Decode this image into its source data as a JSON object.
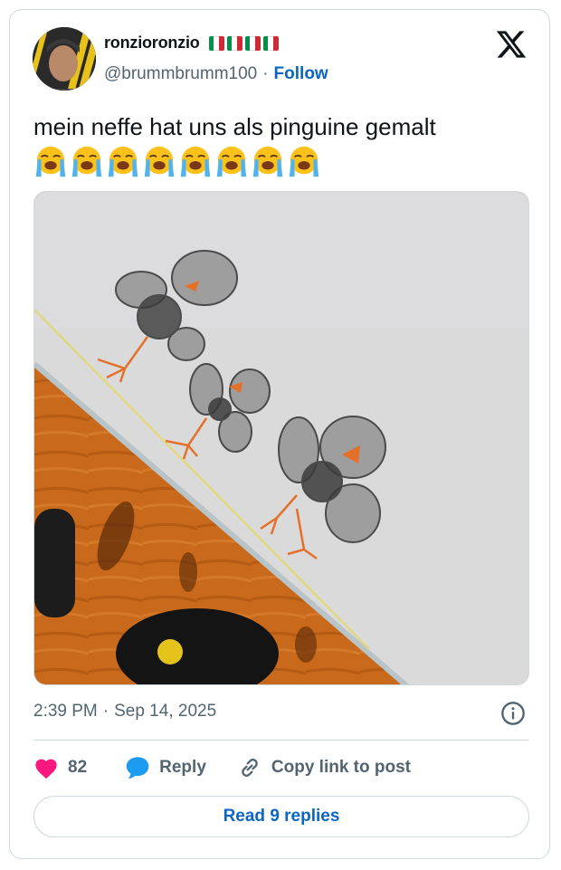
{
  "user": {
    "display_name": "ronzioronzio",
    "flags": [
      "italy-flag",
      "italy-flag",
      "italy-flag",
      "italy-flag"
    ],
    "handle": "@brummbrumm100",
    "separator": "·",
    "follow_label": "Follow"
  },
  "tweet": {
    "text": "mein neffe hat uns als pinguine gemalt",
    "emoji": [
      "loudly-crying-face",
      "loudly-crying-face",
      "loudly-crying-face",
      "loudly-crying-face",
      "loudly-crying-face",
      "loudly-crying-face",
      "loudly-crying-face",
      "loudly-crying-face"
    ]
  },
  "meta": {
    "time": "2:39 PM",
    "separator": "·",
    "date": "Sep 14, 2025"
  },
  "actions": {
    "likes": "82",
    "reply_label": "Reply",
    "copy_label": "Copy link to post"
  },
  "read_replies": "Read 9 replies",
  "colors": {
    "accent": "#0a66c2",
    "like": "#f91880",
    "reply": "#1d9bf0",
    "muted": "#536471",
    "border": "#cfd9de"
  }
}
